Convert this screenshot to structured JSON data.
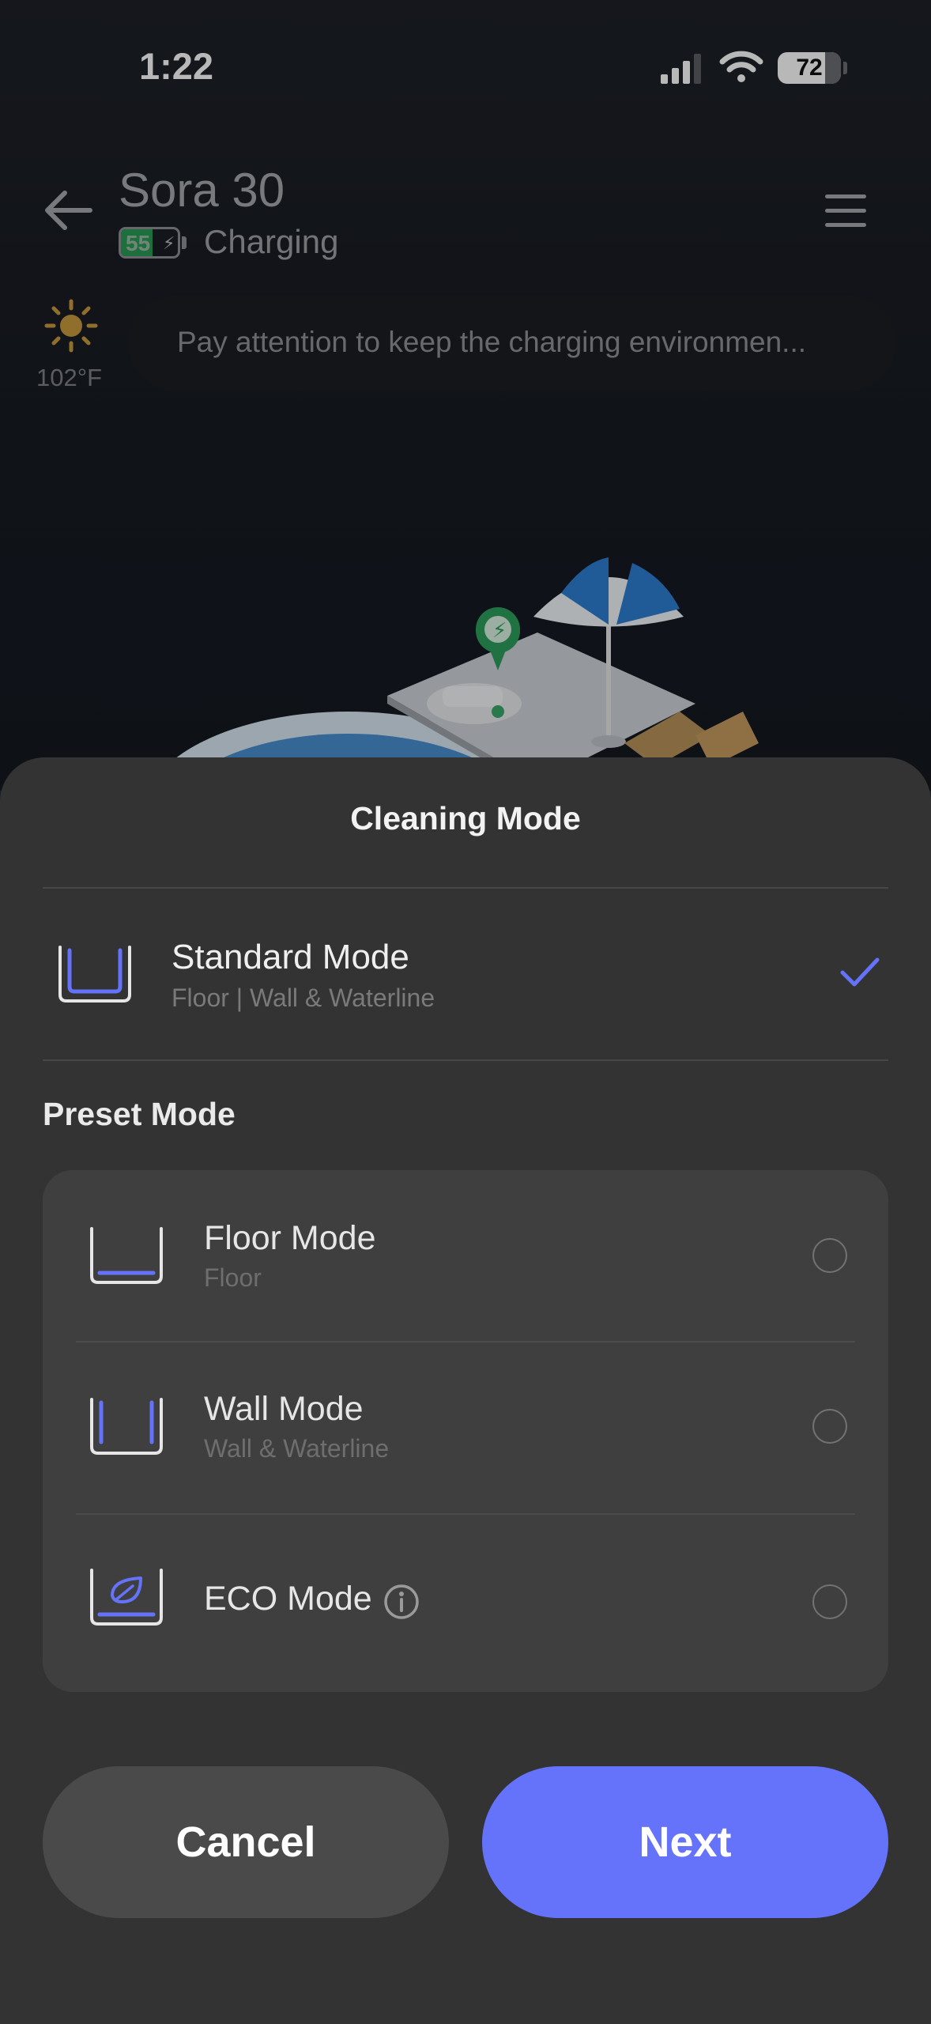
{
  "status_bar": {
    "time": "1:22",
    "battery": "72"
  },
  "header": {
    "device_name": "Sora 30",
    "device_battery": "55",
    "status": "Charging"
  },
  "weather": {
    "temperature": "102°F",
    "icon": "sun-icon"
  },
  "notice": {
    "text": "Pay attention to keep the charging environmen..."
  },
  "sheet": {
    "title": "Cleaning Mode",
    "standard": {
      "title": "Standard Mode",
      "subtitle": "Floor | Wall & Waterline",
      "selected": true
    },
    "preset_heading": "Preset Mode",
    "presets": [
      {
        "title": "Floor Mode",
        "subtitle": "Floor",
        "icon": "floor-mode-icon"
      },
      {
        "title": "Wall Mode",
        "subtitle": "Wall & Waterline",
        "icon": "wall-mode-icon"
      },
      {
        "title": "ECO Mode",
        "subtitle": "",
        "icon": "eco-mode-icon"
      }
    ],
    "buttons": {
      "cancel": "Cancel",
      "next": "Next"
    }
  },
  "colors": {
    "accent": "#6473fa",
    "sheet_bg": "#333333",
    "card_bg": "#3f3f3f",
    "charging_green": "#2a9a56"
  }
}
